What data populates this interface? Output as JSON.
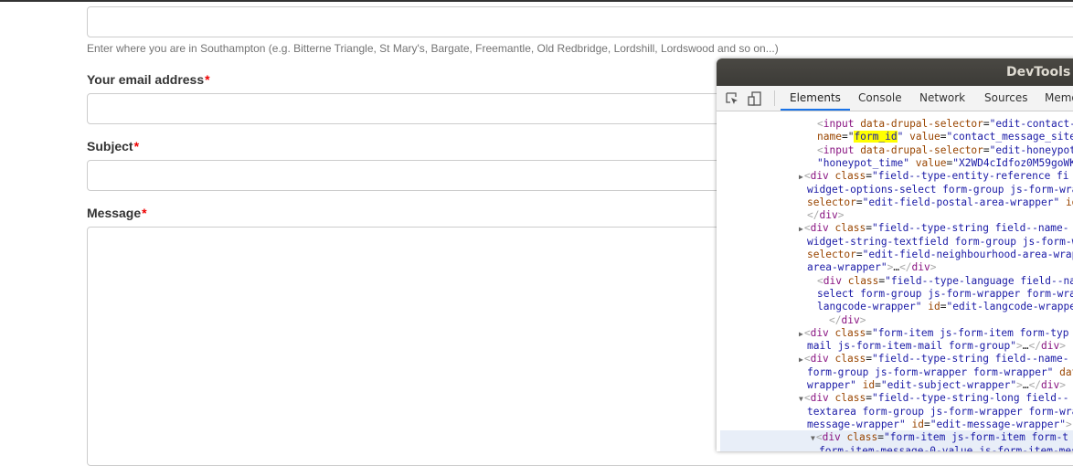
{
  "form": {
    "neighbourhood_help": "Enter where you are in Southampton (e.g. Bitterne Triangle, St Mary's, Bargate, Freemantle, Old Redbridge, Lordshill, Lordswood and so on...)",
    "email_label": "Your email address",
    "subject_label": "Subject",
    "message_label": "Message",
    "required_mark": "*"
  },
  "devtools": {
    "title": "DevTools - ",
    "tabs": [
      "Elements",
      "Console",
      "Network",
      "Sources",
      "Memo"
    ],
    "active_tab": "Elements",
    "icons": [
      "inspect-element-icon",
      "device-toolbar-icon"
    ],
    "lines": [
      {
        "depth": 2,
        "arrow": "",
        "tokens": [
          [
            "p",
            "<"
          ],
          [
            "tag",
            "input"
          ],
          [
            "x",
            " "
          ],
          [
            "attr",
            "data-drupal-selector"
          ],
          [
            "x",
            "="
          ],
          [
            "val",
            "\"edit-contact-m"
          ]
        ]
      },
      {
        "depth": 2,
        "arrow": "",
        "tokens": [
          [
            "attr",
            "name"
          ],
          [
            "x",
            "=\""
          ],
          [
            "hl",
            "form_id"
          ],
          [
            "val",
            "\""
          ],
          [
            "x",
            " "
          ],
          [
            "attr",
            "value"
          ],
          [
            "x",
            "="
          ],
          [
            "val",
            "\"contact_message_sitew"
          ]
        ]
      },
      {
        "depth": 2,
        "arrow": "",
        "tokens": [
          [
            "p",
            "<"
          ],
          [
            "tag",
            "input"
          ],
          [
            "x",
            " "
          ],
          [
            "attr",
            "data-drupal-selector"
          ],
          [
            "x",
            "="
          ],
          [
            "val",
            "\"edit-honeypot-"
          ]
        ]
      },
      {
        "depth": 2,
        "arrow": "",
        "tokens": [
          [
            "val",
            "\"honeypot_time\""
          ],
          [
            "x",
            " "
          ],
          [
            "attr",
            "value"
          ],
          [
            "x",
            "="
          ],
          [
            "val",
            "\"X2WD4cIdfoz0M59goWK3"
          ]
        ]
      },
      {
        "depth": 1,
        "arrow": "▶",
        "tokens": [
          [
            "p",
            "<"
          ],
          [
            "tag",
            "div"
          ],
          [
            "x",
            " "
          ],
          [
            "attr",
            "class"
          ],
          [
            "x",
            "="
          ],
          [
            "val",
            "\"field--type-entity-reference fi"
          ]
        ]
      },
      {
        "depth": 0,
        "arrow": "",
        "tokens": [
          [
            "val",
            "widget-options-select form-group js-form-wra"
          ]
        ]
      },
      {
        "depth": 0,
        "arrow": "",
        "tokens": [
          [
            "attr",
            "selector"
          ],
          [
            "x",
            "="
          ],
          [
            "val",
            "\"edit-field-postal-area-wrapper\""
          ],
          [
            "x",
            " "
          ],
          [
            "attr",
            "id"
          ]
        ]
      },
      {
        "depth": 0,
        "arrow": "",
        "tokens": [
          [
            "p",
            "</"
          ],
          [
            "tag",
            "div"
          ],
          [
            "p",
            ">"
          ]
        ]
      },
      {
        "depth": 1,
        "arrow": "▶",
        "tokens": [
          [
            "p",
            "<"
          ],
          [
            "tag",
            "div"
          ],
          [
            "x",
            " "
          ],
          [
            "attr",
            "class"
          ],
          [
            "x",
            "="
          ],
          [
            "val",
            "\"field--type-string field--name-"
          ]
        ]
      },
      {
        "depth": 0,
        "arrow": "",
        "tokens": [
          [
            "val",
            "widget-string-textfield form-group js-form-w"
          ]
        ]
      },
      {
        "depth": 0,
        "arrow": "",
        "tokens": [
          [
            "attr",
            "selector"
          ],
          [
            "x",
            "="
          ],
          [
            "val",
            "\"edit-field-neighbourhood-area-wrap"
          ]
        ]
      },
      {
        "depth": 0,
        "arrow": "",
        "tokens": [
          [
            "val",
            "area-wrapper\""
          ],
          [
            "p",
            ">"
          ],
          [
            "x",
            "…"
          ],
          [
            "p",
            "</"
          ],
          [
            "tag",
            "div"
          ],
          [
            "p",
            ">"
          ]
        ]
      },
      {
        "depth": 2,
        "arrow": "",
        "tokens": [
          [
            "p",
            "<"
          ],
          [
            "tag",
            "div"
          ],
          [
            "x",
            " "
          ],
          [
            "attr",
            "class"
          ],
          [
            "x",
            "="
          ],
          [
            "val",
            "\"field--type-language field--nam"
          ]
        ]
      },
      {
        "depth": 2,
        "arrow": "",
        "tokens": [
          [
            "val",
            "select form-group js-form-wrapper form-wrap"
          ]
        ]
      },
      {
        "depth": 2,
        "arrow": "",
        "tokens": [
          [
            "val",
            "langcode-wrapper\""
          ],
          [
            "x",
            " "
          ],
          [
            "attr",
            "id"
          ],
          [
            "x",
            "="
          ],
          [
            "val",
            "\"edit-langcode-wrapper"
          ]
        ]
      },
      {
        "depth": 3,
        "arrow": "",
        "tokens": [
          [
            "p",
            "</"
          ],
          [
            "tag",
            "div"
          ],
          [
            "p",
            ">"
          ]
        ]
      },
      {
        "depth": 1,
        "arrow": "▶",
        "tokens": [
          [
            "p",
            "<"
          ],
          [
            "tag",
            "div"
          ],
          [
            "x",
            " "
          ],
          [
            "attr",
            "class"
          ],
          [
            "x",
            "="
          ],
          [
            "val",
            "\"form-item js-form-item form-typ"
          ]
        ]
      },
      {
        "depth": 0,
        "arrow": "",
        "tokens": [
          [
            "val",
            "mail js-form-item-mail form-group\""
          ],
          [
            "p",
            ">"
          ],
          [
            "x",
            "…"
          ],
          [
            "p",
            "</"
          ],
          [
            "tag",
            "div"
          ],
          [
            "p",
            ">"
          ]
        ]
      },
      {
        "depth": 1,
        "arrow": "▶",
        "tokens": [
          [
            "p",
            "<"
          ],
          [
            "tag",
            "div"
          ],
          [
            "x",
            " "
          ],
          [
            "attr",
            "class"
          ],
          [
            "x",
            "="
          ],
          [
            "val",
            "\"field--type-string field--name-"
          ]
        ]
      },
      {
        "depth": 0,
        "arrow": "",
        "tokens": [
          [
            "val",
            "form-group js-form-wrapper form-wrapper\""
          ],
          [
            "x",
            " "
          ],
          [
            "attr",
            "dat"
          ]
        ]
      },
      {
        "depth": 0,
        "arrow": "",
        "tokens": [
          [
            "val",
            "wrapper\""
          ],
          [
            "x",
            " "
          ],
          [
            "attr",
            "id"
          ],
          [
            "x",
            "="
          ],
          [
            "val",
            "\"edit-subject-wrapper\""
          ],
          [
            "p",
            ">"
          ],
          [
            "x",
            "…"
          ],
          [
            "p",
            "</"
          ],
          [
            "tag",
            "div"
          ],
          [
            "p",
            ">"
          ]
        ]
      },
      {
        "depth": 1,
        "arrow": "▼",
        "tokens": [
          [
            "p",
            "<"
          ],
          [
            "tag",
            "div"
          ],
          [
            "x",
            " "
          ],
          [
            "attr",
            "class"
          ],
          [
            "x",
            "="
          ],
          [
            "val",
            "\"field--type-string-long field--"
          ]
        ]
      },
      {
        "depth": 0,
        "arrow": "",
        "tokens": [
          [
            "val",
            "textarea form-group js-form-wrapper form-wra"
          ]
        ]
      },
      {
        "depth": 0,
        "arrow": "",
        "tokens": [
          [
            "val",
            "message-wrapper\""
          ],
          [
            "x",
            " "
          ],
          [
            "attr",
            "id"
          ],
          [
            "x",
            "="
          ],
          [
            "val",
            "\"edit-message-wrapper\""
          ],
          [
            "p",
            ">"
          ]
        ]
      },
      {
        "depth": 4,
        "arrow": "▼",
        "selected": true,
        "tokens": [
          [
            "p",
            "<"
          ],
          [
            "tag",
            "div"
          ],
          [
            "x",
            " "
          ],
          [
            "attr",
            "class"
          ],
          [
            "x",
            "="
          ],
          [
            "val",
            "\"form-item js-form-item form-t"
          ]
        ]
      },
      {
        "depth": 5,
        "arrow": "",
        "selected": true,
        "tokens": [
          [
            "val",
            "form-item-message-0-value js-form-item-mes"
          ]
        ]
      }
    ]
  }
}
